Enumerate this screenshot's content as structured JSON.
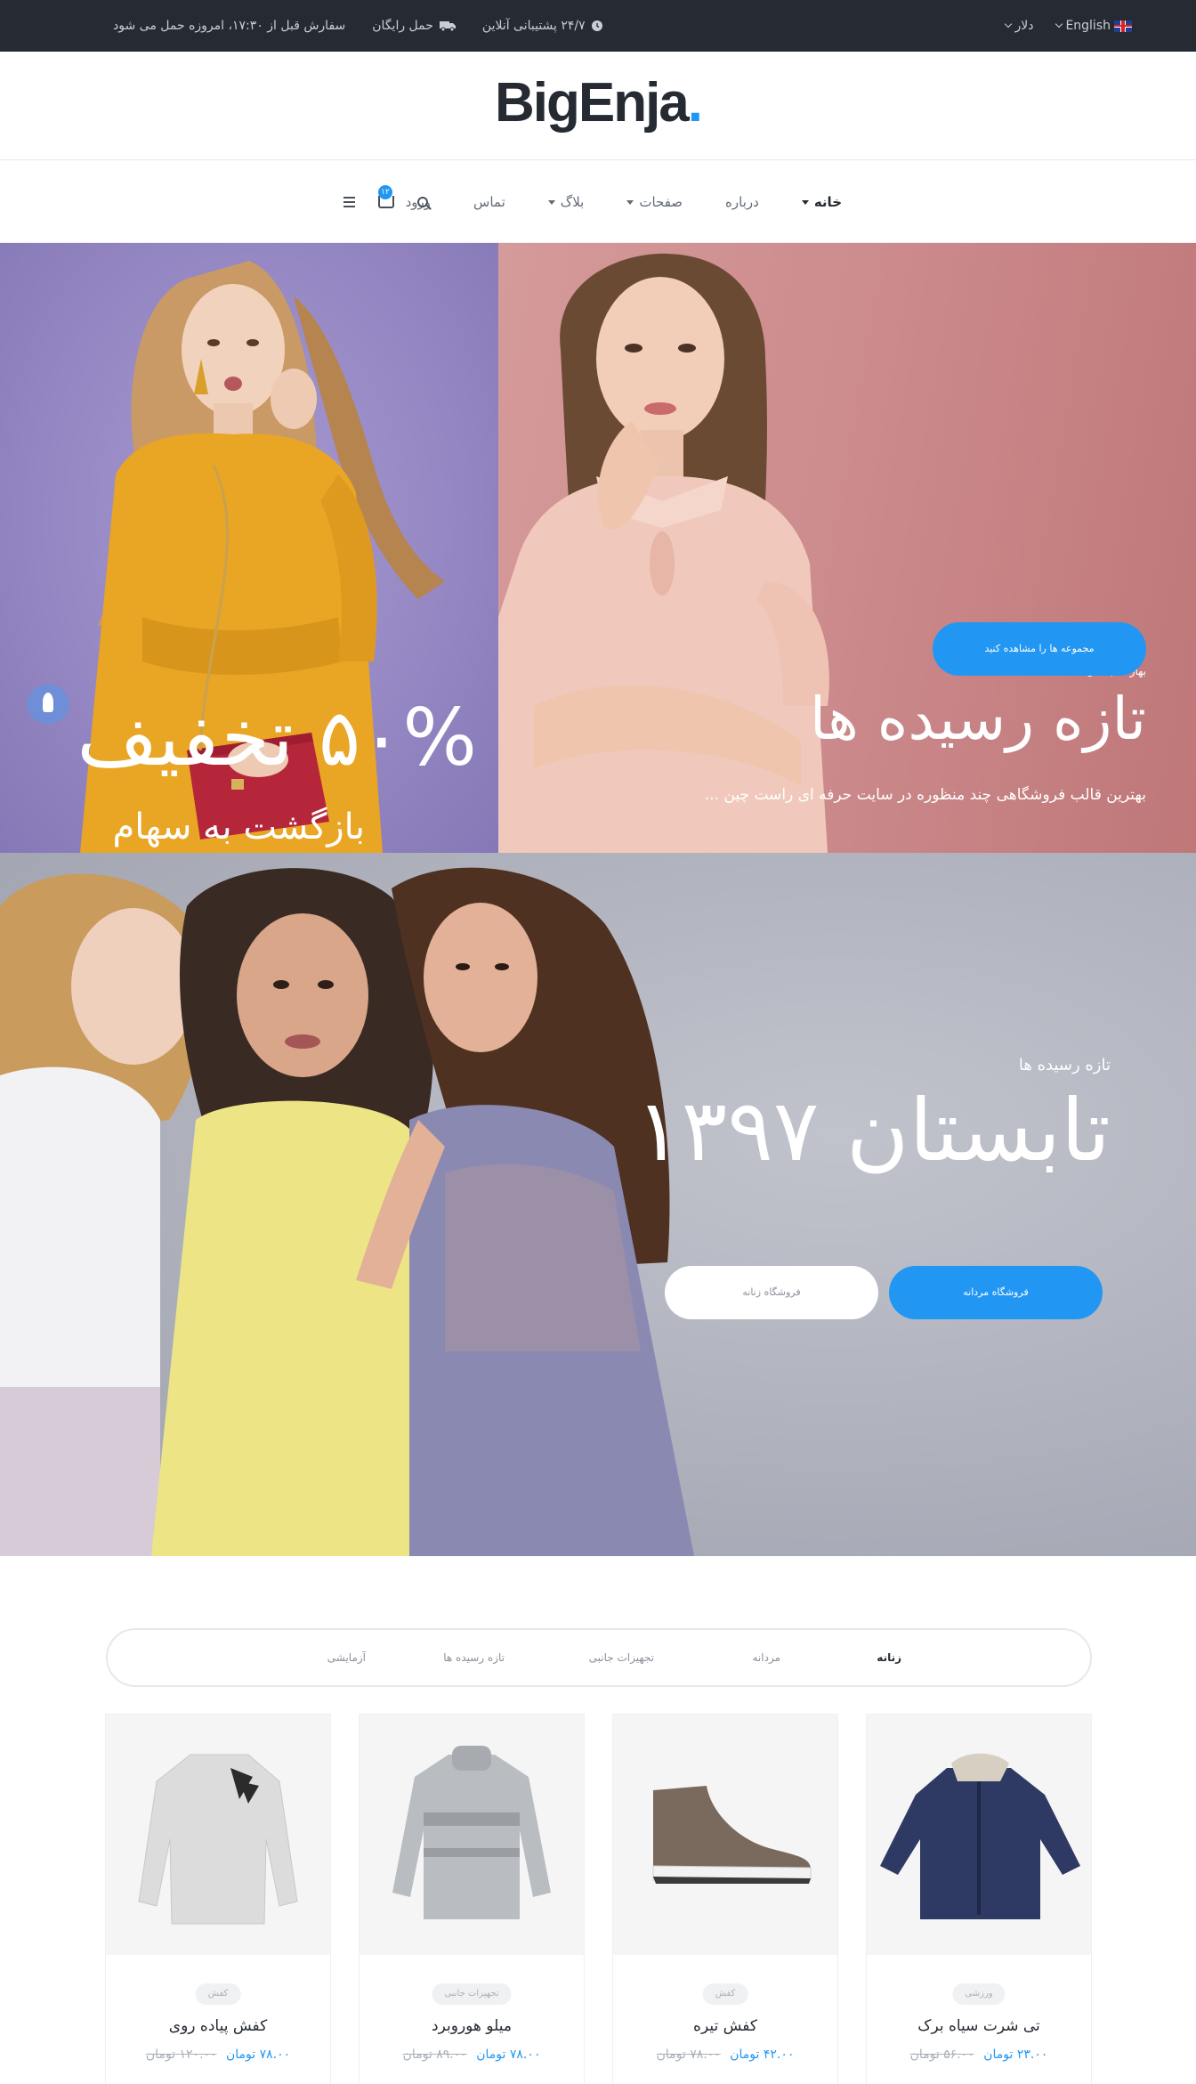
{
  "topbar": {
    "support": "۲۴/۷ پشتیبانی آنلاین",
    "shipping": "حمل رایگان",
    "order_note": "سفارش قبل از ۱۷:۳۰، امروزه حمل می شود",
    "currency": "دلار",
    "language": "English"
  },
  "brand": {
    "name": "BigEnja",
    "dot": "."
  },
  "nav": {
    "items": [
      {
        "label": "خانه"
      },
      {
        "label": "درباره"
      },
      {
        "label": "صفحات"
      },
      {
        "label": "بلاگ"
      },
      {
        "label": "تماس"
      },
      {
        "label": "ورود"
      }
    ],
    "cart_count": "۱۲"
  },
  "hero_sale": {
    "title": "۵۰% تخفیف",
    "subtitle": "بازگشت به سهام"
  },
  "hero_new": {
    "kicker": "بهار - تابستان ۱۳۹۷",
    "title": "تازه رسیده ها",
    "description": "بهترین قالب فروشگاهی چند منظوره در سایت حرفه ای راست چین ...",
    "button": "مجموعه ها را مشاهده کنید"
  },
  "hero_summer": {
    "kicker": "تازه رسیده ها",
    "title": "تابستان ۱۳۹۷",
    "button_primary": "فروشگاه مردانه",
    "button_secondary": "فروشگاه زنانه"
  },
  "tabs": [
    "زنانه",
    "مردانه",
    "تجهیزات جانبی",
    "تازه رسیده ها",
    "آزمایشی"
  ],
  "products": [
    {
      "category": "ورزشی",
      "name": "تی شرت سیاه برک",
      "price": "۲۳.۰۰ تومان",
      "old_price": "۵۶.۰۰ تومان"
    },
    {
      "category": "کفش",
      "name": "کفش تیره",
      "price": "۴۲.۰۰ تومان",
      "old_price": "۷۸.۰۰ تومان"
    },
    {
      "category": "تجهیزات جانبی",
      "name": "میلو هوروبرد",
      "price": "۷۸.۰۰ تومان",
      "old_price": "۸۹.۰۰ تومان"
    },
    {
      "category": "کفش",
      "name": "کفش پیاده روی",
      "price": "۷۸.۰۰ تومان",
      "old_price": "۱۲۰.۰۰ تومان"
    }
  ],
  "colors": {
    "accent": "#2196f3",
    "dark": "#262b33"
  }
}
